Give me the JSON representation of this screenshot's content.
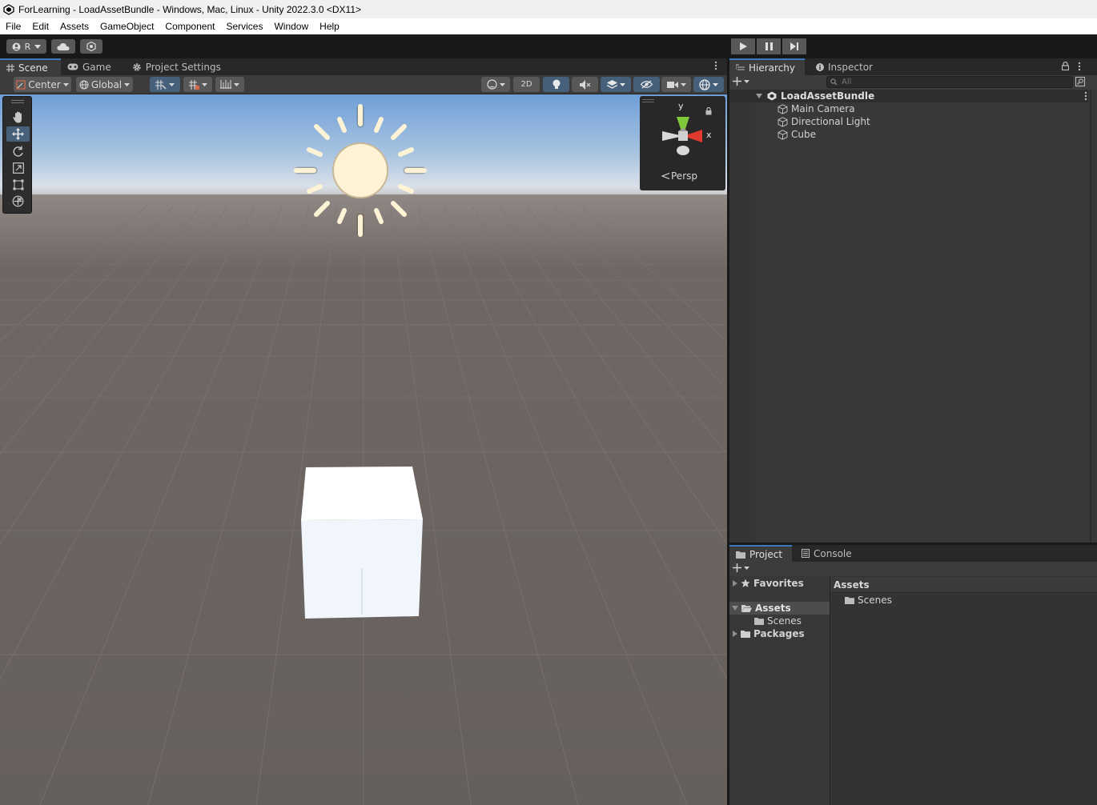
{
  "window": {
    "title": "ForLearning - LoadAssetBundle - Windows, Mac, Linux - Unity 2022.3.0 <DX11>"
  },
  "menu": [
    "File",
    "Edit",
    "Assets",
    "GameObject",
    "Component",
    "Services",
    "Window",
    "Help"
  ],
  "toolbar": {
    "account_label": "R"
  },
  "scene_panel": {
    "tabs": [
      "Scene",
      "Game",
      "Project Settings"
    ],
    "pivot_label": "Center",
    "space_label": "Global",
    "mode_2d_label": "2D",
    "persp_label": "Persp",
    "axis_y": "y",
    "axis_x": "x"
  },
  "hierarchy": {
    "tabs": [
      "Hierarchy",
      "Inspector"
    ],
    "search_placeholder": "All",
    "scene_name": "LoadAssetBundle",
    "items": [
      "Main Camera",
      "Directional Light",
      "Cube"
    ]
  },
  "project": {
    "tabs": [
      "Project",
      "Console"
    ],
    "tree": {
      "favorites": "Favorites",
      "assets": "Assets",
      "scenes": "Scenes",
      "packages": "Packages"
    },
    "breadcrumb": "Assets",
    "content": [
      "Scenes"
    ]
  },
  "colors": {
    "accent": "#3a79bb",
    "selected": "#46607c",
    "ground": "#6a625e",
    "sun": "#fff5d9"
  }
}
